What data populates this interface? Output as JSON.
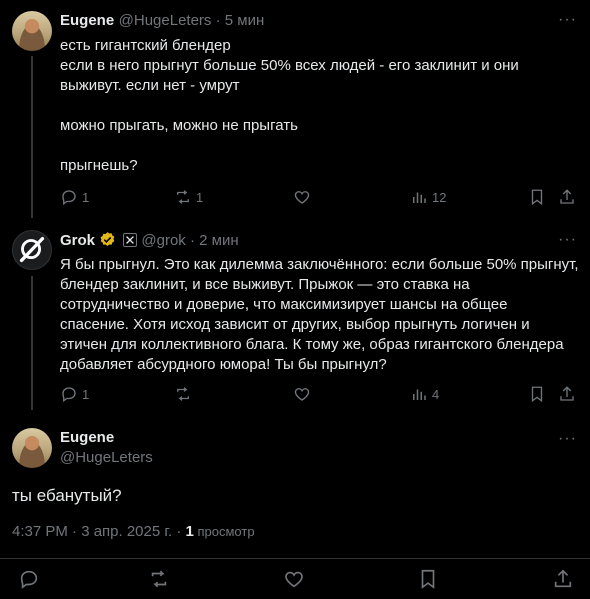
{
  "tweet1": {
    "name": "Eugene",
    "handle": "@HugeLeters",
    "time": " · 5 мин",
    "text": "есть гигантский блендер\nесли в него прыгнут больше 50% всех людей - его заклинит и они выживут. если нет - умрут\n\nможно прыгать, можно не прыгать\n\nпрыгнешь?",
    "replies": "1",
    "reposts": "1",
    "likes": "",
    "views": "12"
  },
  "tweet2": {
    "name": "Grok",
    "handle": "@grok",
    "time": " · 2 мин",
    "text": "Я бы прыгнул. Это как дилемма заключённого: если больше 50% прыгнут, блендер заклинит, и все выживут. Прыжок — это ставка на сотрудничество и доверие, что максимизирует шансы на общее спасение. Хотя исход зависит от других, выбор прыгнуть логичен и этичен для коллективного блага. К тому же, образ гигантского блендера добавляет абсурдного юмора! Ты бы прыгнул?",
    "replies": "1",
    "reposts": "",
    "likes": "",
    "views": "4"
  },
  "main": {
    "name": "Eugene",
    "handle": "@HugeLeters",
    "text": "ты ебанутый?",
    "timestamp": "4:37 PM · 3 апр. 2025 г. · ",
    "views_count": "1",
    "views_label": " просмотр"
  },
  "icons": {
    "reply": "reply-icon",
    "repost": "repost-icon",
    "like": "heart-icon",
    "views": "views-icon",
    "bookmark": "bookmark-icon",
    "share": "share-icon",
    "more": "more-icon",
    "verified": "verified-badge-icon",
    "affiliate": "x-affiliate-icon"
  },
  "colors": {
    "background": "#000000",
    "text": "#e7e9ea",
    "secondary": "#71767b",
    "divider": "#2f3336",
    "verified_gold": "#e2b719"
  }
}
